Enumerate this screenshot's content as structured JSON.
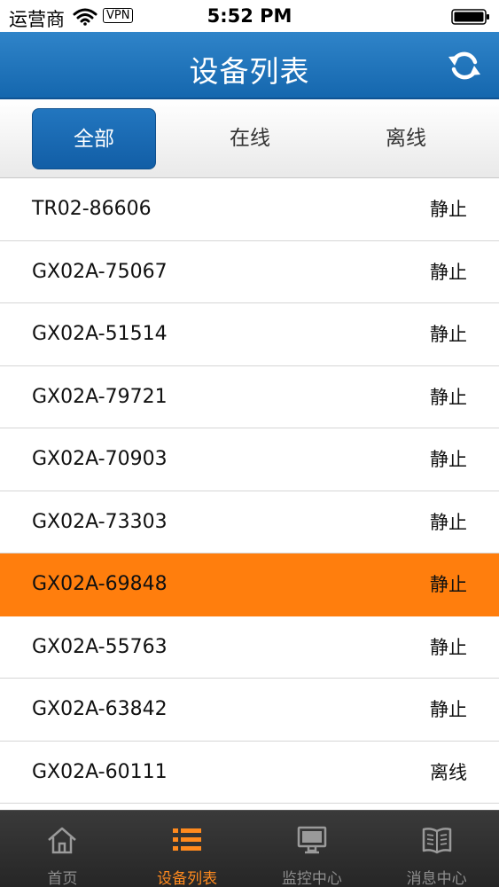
{
  "status_bar": {
    "carrier": "运营商",
    "vpn": "VPN",
    "time": "5:52 PM"
  },
  "nav": {
    "title": "设备列表",
    "refresh_icon": "refresh-icon"
  },
  "filter_tabs": [
    {
      "label": "全部",
      "active": true
    },
    {
      "label": "在线",
      "active": false
    },
    {
      "label": "离线",
      "active": false
    }
  ],
  "devices": [
    {
      "name": "TR02-86606",
      "status": "静止"
    },
    {
      "name": "GX02A-75067",
      "status": "静止"
    },
    {
      "name": "GX02A-51514",
      "status": "静止"
    },
    {
      "name": "GX02A-79721",
      "status": "静止"
    },
    {
      "name": "GX02A-70903",
      "status": "静止"
    },
    {
      "name": "GX02A-73303",
      "status": "静止"
    },
    {
      "name": "GX02A-69848",
      "status": "静止",
      "selected": true
    },
    {
      "name": "GX02A-55763",
      "status": "静止"
    },
    {
      "name": "GX02A-63842",
      "status": "静止"
    },
    {
      "name": "GX02A-60111",
      "status": "离线"
    }
  ],
  "tab_bar": [
    {
      "label": "首页",
      "icon": "home-icon",
      "active": false
    },
    {
      "label": "设备列表",
      "icon": "list-icon",
      "active": true
    },
    {
      "label": "监控中心",
      "icon": "monitor-icon",
      "active": false
    },
    {
      "label": "消息中心",
      "icon": "book-icon",
      "active": false
    }
  ],
  "colors": {
    "nav_blue": "#1a6db5",
    "selected_row": "#ff7e0d",
    "active_tab": "#ff8a1e"
  }
}
